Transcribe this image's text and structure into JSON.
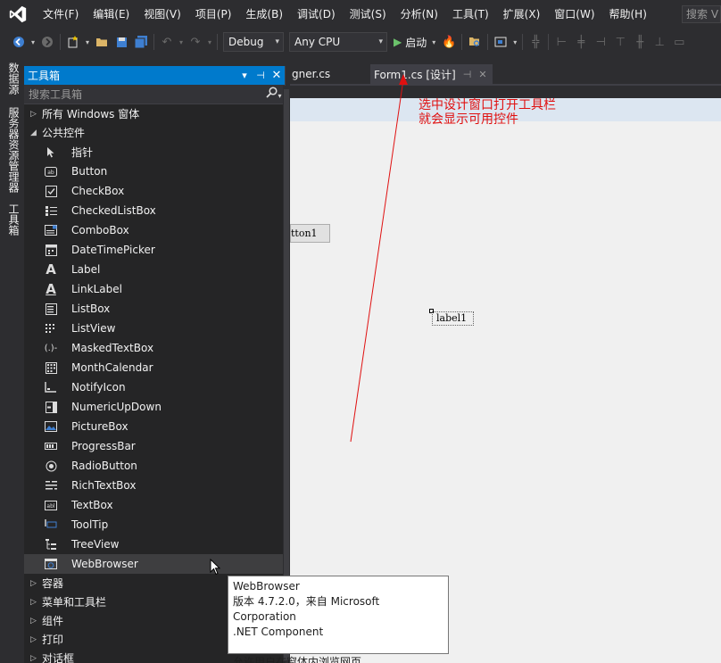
{
  "menubar": {
    "items": [
      "文件(F)",
      "编辑(E)",
      "视图(V)",
      "项目(P)",
      "生成(B)",
      "调试(D)",
      "测试(S)",
      "分析(N)",
      "工具(T)",
      "扩展(X)",
      "窗口(W)",
      "帮助(H)"
    ],
    "search_placeholder": "搜索 V"
  },
  "toolbar": {
    "config": "Debug",
    "platform": "Any CPU",
    "start_label": "启动"
  },
  "side_tabs": [
    "数据源",
    "服务器资源管理器",
    "工具箱"
  ],
  "toolbox": {
    "title": "工具箱",
    "search_placeholder": "搜索工具箱",
    "groups_top": [
      {
        "label": "所有 Windows 窗体",
        "expanded": false
      }
    ],
    "common_group": {
      "label": "公共控件",
      "expanded": true
    },
    "items": [
      {
        "label": "指针",
        "icon": "pointer-icon"
      },
      {
        "label": "Button",
        "icon": "button-icon"
      },
      {
        "label": "CheckBox",
        "icon": "checkbox-icon"
      },
      {
        "label": "CheckedListBox",
        "icon": "checkedlistbox-icon"
      },
      {
        "label": "ComboBox",
        "icon": "combobox-icon"
      },
      {
        "label": "DateTimePicker",
        "icon": "datetimepicker-icon"
      },
      {
        "label": "Label",
        "icon": "label-icon"
      },
      {
        "label": "LinkLabel",
        "icon": "linklabel-icon"
      },
      {
        "label": "ListBox",
        "icon": "listbox-icon"
      },
      {
        "label": "ListView",
        "icon": "listview-icon"
      },
      {
        "label": "MaskedTextBox",
        "icon": "maskedtextbox-icon"
      },
      {
        "label": "MonthCalendar",
        "icon": "monthcalendar-icon"
      },
      {
        "label": "NotifyIcon",
        "icon": "notifyicon-icon"
      },
      {
        "label": "NumericUpDown",
        "icon": "numericupdown-icon"
      },
      {
        "label": "PictureBox",
        "icon": "picturebox-icon"
      },
      {
        "label": "ProgressBar",
        "icon": "progressbar-icon"
      },
      {
        "label": "RadioButton",
        "icon": "radiobutton-icon"
      },
      {
        "label": "RichTextBox",
        "icon": "richtextbox-icon"
      },
      {
        "label": "TextBox",
        "icon": "textbox-icon"
      },
      {
        "label": "ToolTip",
        "icon": "tooltip-icon"
      },
      {
        "label": "TreeView",
        "icon": "treeview-icon"
      },
      {
        "label": "WebBrowser",
        "icon": "webbrowser-icon",
        "selected": true
      }
    ],
    "groups_bottom": [
      "容器",
      "菜单和工具栏",
      "组件",
      "打印",
      "对话框"
    ]
  },
  "doc_tabs": [
    {
      "label": "gner.cs",
      "active": false
    },
    {
      "label": "Form1.cs [设计]",
      "active": true
    }
  ],
  "designer": {
    "button_text": "tton1",
    "label_text": "label1"
  },
  "annotation": {
    "line1": "选中设计窗口打开工具栏",
    "line2": "就会显示可用控件",
    "color": "#e01010"
  },
  "tooltip": {
    "title": "WebBrowser",
    "version": "版本 4.7.2.0，来自 Microsoft Corporation",
    "kind": ".NET Component",
    "description": "允许用户在窗体内浏览网页。"
  },
  "colors": {
    "accent": "#007acc",
    "background": "#2d2d30",
    "panel": "#252526"
  }
}
